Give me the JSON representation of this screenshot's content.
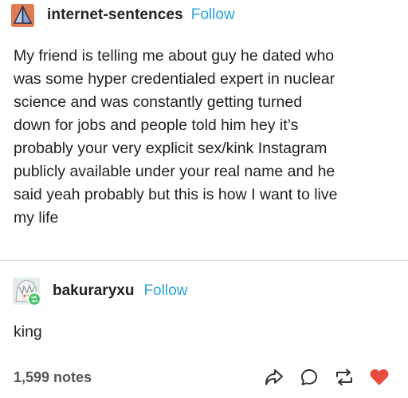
{
  "post": {
    "blog_name": "internet-sentences",
    "follow_label": "Follow",
    "avatar_icon": "pyramid-logo-icon",
    "body_lines": [
      "My friend is telling me about guy he dated who",
      "was some hyper credentialed expert in nuclear",
      "science and was constantly getting turned",
      "down for jobs and people told him hey it’s",
      "probably your very explicit sex/kink Instagram",
      "publicly available under your real name and he",
      "said yeah probably but this is how I want to live",
      "my life"
    ]
  },
  "reply": {
    "blog_name": "bakuraryxu",
    "follow_label": "Follow",
    "avatar_icon": "anime-avatar-icon",
    "badge_icon": "reblog-badge-icon",
    "body": "king"
  },
  "footer": {
    "notes": "1,599 notes",
    "actions": [
      {
        "name": "share-icon"
      },
      {
        "name": "reply-icon"
      },
      {
        "name": "reblog-icon"
      },
      {
        "name": "like-icon"
      }
    ]
  },
  "colors": {
    "follow": "#2aa3d6",
    "like": "#e74c3c",
    "reblog_badge": "#4cc46c",
    "avatar1": "#e07b53"
  }
}
